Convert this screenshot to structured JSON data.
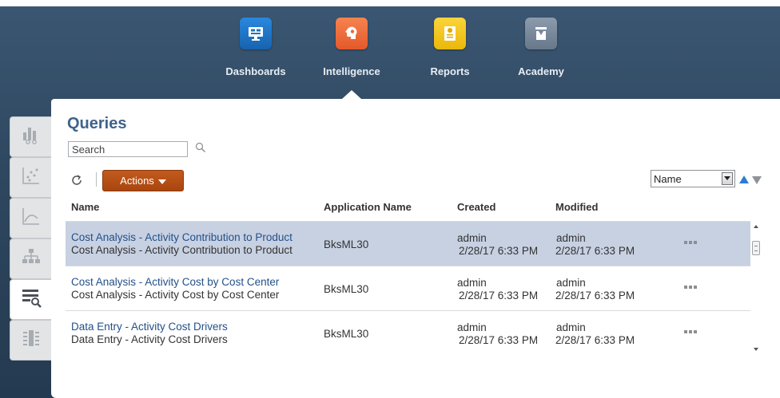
{
  "nav": {
    "items": [
      {
        "label": "Dashboards",
        "icon": "dashboard-icon",
        "color": "#1a76c8"
      },
      {
        "label": "Intelligence",
        "icon": "brain-icon",
        "color": "#ef6a34"
      },
      {
        "label": "Reports",
        "icon": "report-icon",
        "color": "#f5c416"
      },
      {
        "label": "Academy",
        "icon": "academy-icon",
        "color": "#7a8a9c"
      }
    ],
    "active": "Intelligence"
  },
  "sidebar": {
    "tabs": [
      {
        "icon": "bar-chart-icon"
      },
      {
        "icon": "scatter-plot-icon"
      },
      {
        "icon": "curve-chart-icon"
      },
      {
        "icon": "hierarchy-icon"
      },
      {
        "icon": "query-list-icon",
        "active": true
      },
      {
        "icon": "filter-matrix-icon"
      }
    ]
  },
  "main": {
    "title": "Queries",
    "search": {
      "placeholder": "Search",
      "value": ""
    },
    "actions_label": "Actions",
    "sort": {
      "selected": "Name"
    },
    "table": {
      "headers": [
        "Name",
        "Application Name",
        "Created",
        "Modified"
      ],
      "rows": [
        {
          "name": "Cost Analysis - Activity Contribution to Product",
          "description": "Cost Analysis - Activity Contribution to Product",
          "application": "BksML30",
          "created_by": "admin",
          "created": "2/28/17 6:33 PM",
          "modified_by": "admin",
          "modified": "2/28/17 6:33 PM",
          "selected": true
        },
        {
          "name": "Cost Analysis - Activity Cost by Cost Center",
          "description": "Cost Analysis - Activity Cost by Cost Center",
          "application": "BksML30",
          "created_by": "admin",
          "created": "2/28/17 6:33 PM",
          "modified_by": "admin",
          "modified": "2/28/17 6:33 PM",
          "selected": false
        },
        {
          "name": "Data Entry - Activity Cost Drivers",
          "description": "Data Entry - Activity Cost Drivers",
          "application": "BksML30",
          "created_by": "admin",
          "created": "2/28/17 6:33 PM",
          "modified_by": "admin",
          "modified": "2/28/17 6:33 PM",
          "selected": false
        }
      ]
    }
  },
  "colors": {
    "accent": "#3e648c",
    "actions_button": "#b44f15",
    "selected_row": "#c7d1e2",
    "sort_up": "#2e7ccf"
  }
}
